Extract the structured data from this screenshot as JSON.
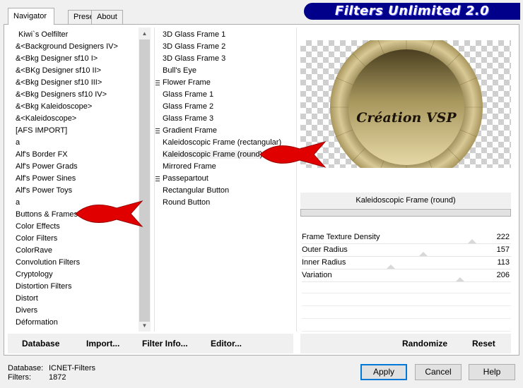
{
  "tabs": [
    {
      "label": "Navigator",
      "active": true
    },
    {
      "label": "Presets",
      "active": false
    },
    {
      "label": "About",
      "active": false
    }
  ],
  "title": "Filters Unlimited 2.0",
  "categories": [
    "Kiwi`s Oelfilter",
    "&<Background Designers IV>",
    "&<Bkg Designer sf10 I>",
    "&<BKg Designer sf10 II>",
    "&<Bkg Designer sf10 III>",
    "&<Bkg Designers sf10 IV>",
    "&<Bkg Kaleidoscope>",
    "&<Kaleidoscope>",
    "[AFS IMPORT]",
    "a",
    "Alf's Border FX",
    "Alf's Power Grads",
    "Alf's Power Sines",
    "Alf's Power Toys",
    "a",
    "Buttons & Frames",
    "Color Effects",
    "Color Filters",
    "ColorRave",
    "Convolution Filters",
    "Cryptology",
    "Distortion Filters",
    "Distort",
    "Divers",
    "Déformation"
  ],
  "filters": [
    {
      "label": "3D Glass Frame 1",
      "group": false
    },
    {
      "label": "3D Glass Frame 2",
      "group": false
    },
    {
      "label": "3D Glass Frame 3",
      "group": false
    },
    {
      "label": "Bull's Eye",
      "group": false
    },
    {
      "label": "Flower Frame",
      "group": true
    },
    {
      "label": "Glass Frame 1",
      "group": false
    },
    {
      "label": "Glass Frame 2",
      "group": false
    },
    {
      "label": "Glass Frame 3",
      "group": false
    },
    {
      "label": "Gradient Frame",
      "group": true
    },
    {
      "label": "Kaleidoscopic Frame (rectangular)",
      "group": false
    },
    {
      "label": "Kaleidoscopic Frame (round)",
      "group": false,
      "selected": true
    },
    {
      "label": "Mirrored Frame",
      "group": false
    },
    {
      "label": "Passepartout",
      "group": true
    },
    {
      "label": "Rectangular Button",
      "group": false
    },
    {
      "label": "Round Button",
      "group": false
    }
  ],
  "preview": {
    "watermark": "Création VSP"
  },
  "selected_filter_name": "Kaleidoscopic Frame (round)",
  "params": [
    {
      "label": "Frame Texture Density",
      "value": "222",
      "level": 222
    },
    {
      "label": "Outer Radius",
      "value": "157",
      "level": 157
    },
    {
      "label": "Inner Radius",
      "value": "113",
      "level": 113
    },
    {
      "label": "Variation",
      "value": "206",
      "level": 206
    }
  ],
  "bottom_buttons": {
    "database": "Database",
    "import": "Import...",
    "filter_info": "Filter Info...",
    "editor": "Editor...",
    "randomize": "Randomize",
    "reset": "Reset"
  },
  "status": {
    "database_label": "Database:",
    "database_value": "ICNET-Filters",
    "filters_label": "Filters:",
    "filters_value": "1872"
  },
  "dialog_buttons": {
    "apply": "Apply",
    "cancel": "Cancel",
    "help": "Help"
  },
  "colors": {
    "banner": "#00008b",
    "arrow": "#e00000",
    "frame_gold": "#c8b47a"
  }
}
